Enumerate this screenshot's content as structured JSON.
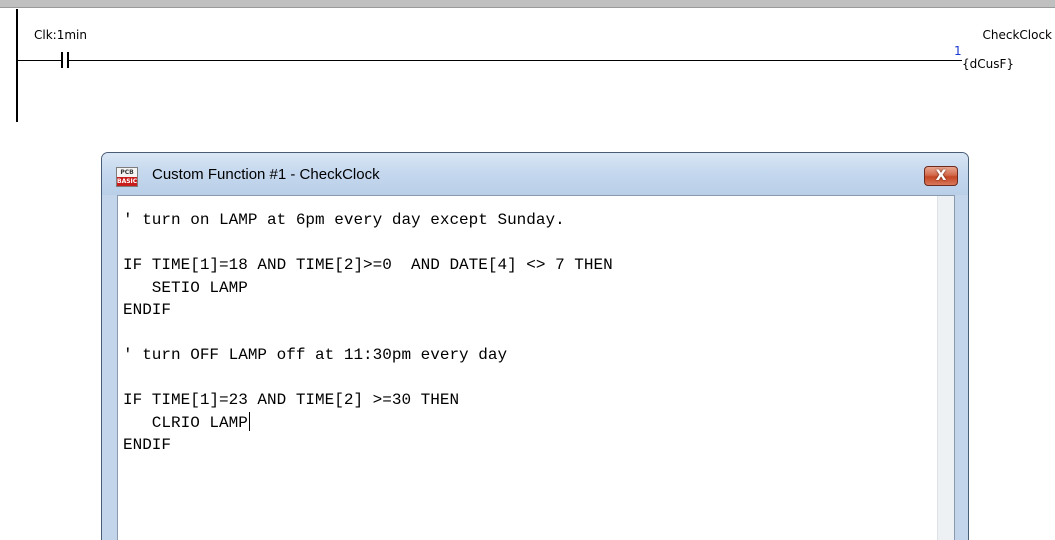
{
  "ladder": {
    "contact_label": "Clk:1min",
    "coil_name": "CheckClock",
    "coil_number": "1",
    "coil_type": "{dCusF}"
  },
  "dialog": {
    "icon_top": "PCB",
    "icon_bottom": "BASIC",
    "title": "Custom Function #1 - CheckClock",
    "close_label": "X",
    "code_lines": [
      "' turn on LAMP at 6pm every day except Sunday.",
      "",
      "IF TIME[1]=18 AND TIME[2]>=0  AND DATE[4] <> 7 THEN",
      "   SETIO LAMP",
      "ENDIF",
      "",
      "' turn OFF LAMP off at 11:30pm every day",
      "",
      "IF TIME[1]=23 AND TIME[2] >=30 THEN",
      "   CLRIO LAMP",
      "ENDIF",
      ""
    ]
  },
  "colors": {
    "title_bar": "#c5d8ee",
    "close_button": "#c44624",
    "coil_number": "#1a3ad0"
  }
}
